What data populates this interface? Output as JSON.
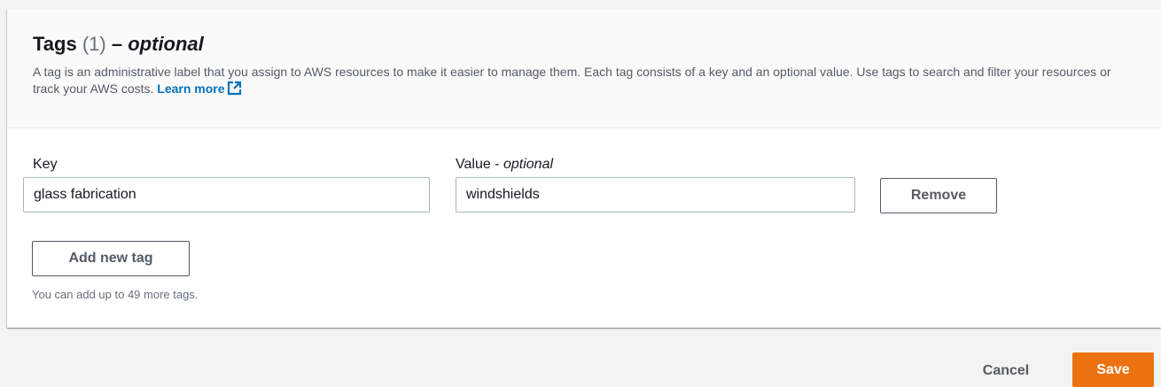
{
  "header": {
    "title": "Tags",
    "count": "(1)",
    "dash": "–",
    "optional": "optional",
    "description": "A tag is an administrative label that you assign to AWS resources to make it easier to manage them. Each tag consists of a key and an optional value. Use tags to search and filter your resources or track your AWS costs.",
    "learn_more": "Learn more",
    "learn_more_icon": "external-link-icon"
  },
  "tag_row": {
    "key_label": "Key",
    "value_label": "Value -",
    "value_label_optional": "optional",
    "key_value": "glass fabrication",
    "value_value": "windshields",
    "remove_label": "Remove"
  },
  "add_tag": {
    "label": "Add new tag",
    "hint": "You can add up to 49 more tags."
  },
  "footer": {
    "cancel_label": "Cancel",
    "save_label": "Save"
  },
  "colors": {
    "link": "#0073bb",
    "primary": "#ec7211",
    "page_bg": "#f2f3f3"
  }
}
